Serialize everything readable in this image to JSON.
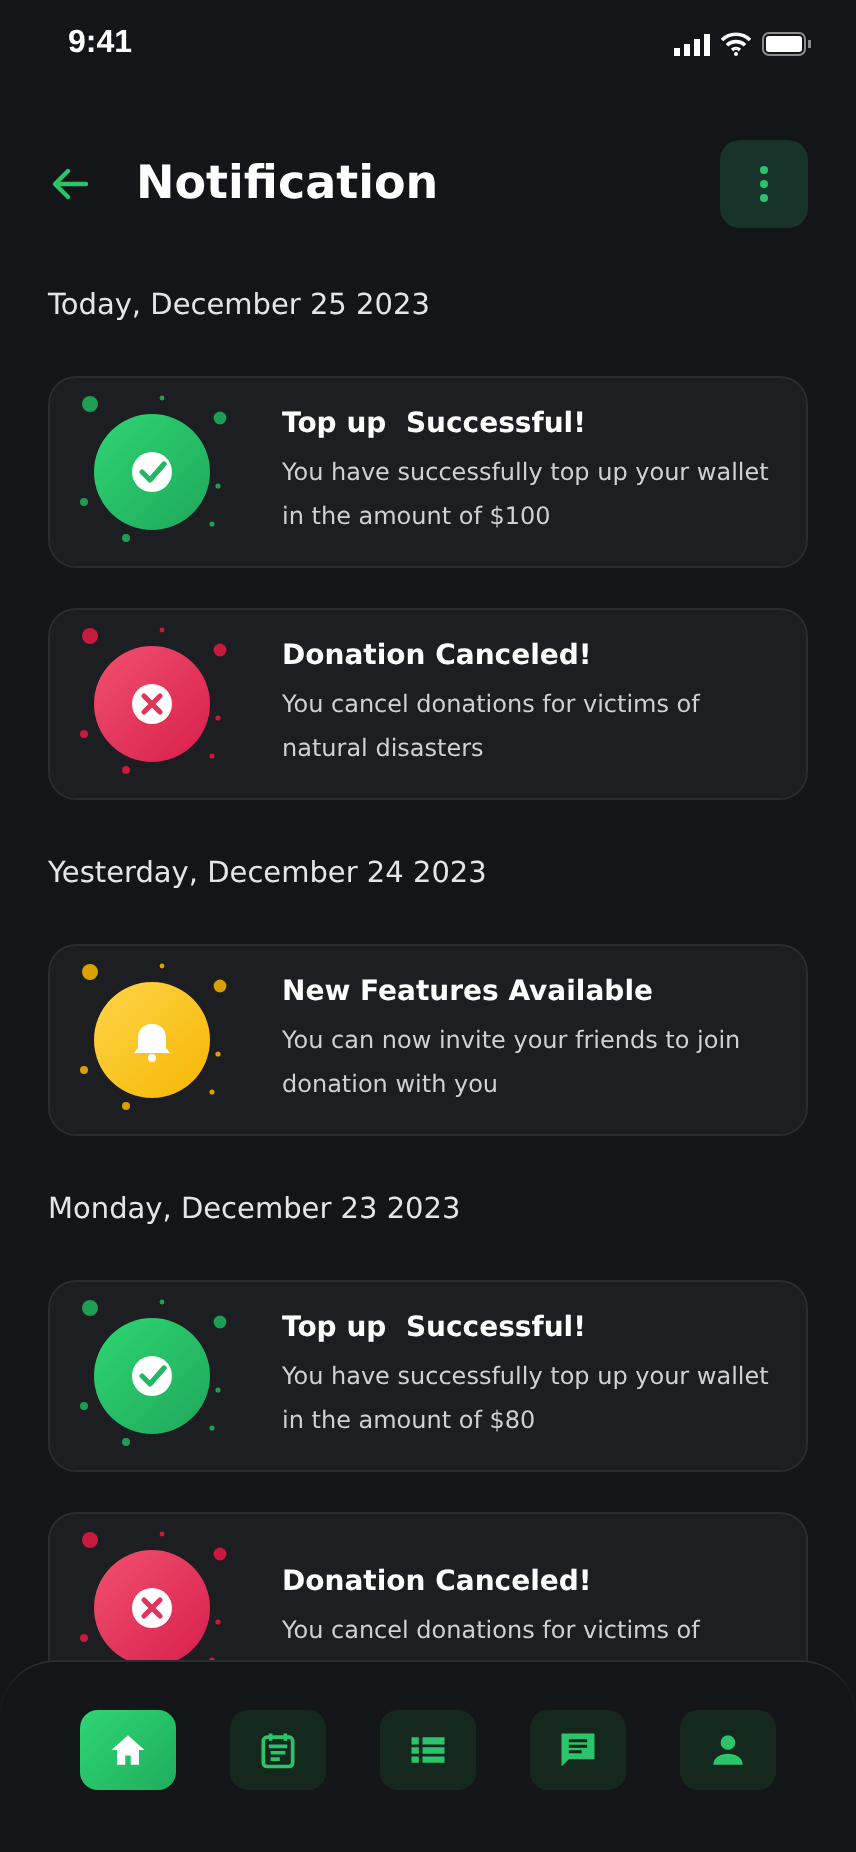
{
  "status_bar": {
    "time": "9:41"
  },
  "header": {
    "title": "Notification"
  },
  "sections": [
    {
      "date": "Today, December 25 2023",
      "notifications": [
        {
          "kind": "success",
          "title": "Top up  Successful!",
          "body": "You have successfully top up your wallet in the amount of $100"
        },
        {
          "kind": "cancel",
          "title": "Donation Canceled!",
          "body": "You cancel donations for victims of natural disasters"
        }
      ]
    },
    {
      "date": "Yesterday, December 24 2023",
      "notifications": [
        {
          "kind": "feature",
          "title": "New Features Available",
          "body": "You can now invite your friends to join donation with you"
        }
      ]
    },
    {
      "date": "Monday, December 23 2023",
      "notifications": [
        {
          "kind": "success",
          "title": "Top up  Successful!",
          "body": "You have successfully top up your wallet in the amount of $80"
        },
        {
          "kind": "cancel",
          "title": "Donation Canceled!",
          "body": "You cancel donations for victims of"
        }
      ]
    }
  ],
  "bottom_nav": [
    {
      "kind": "home",
      "selected": true
    },
    {
      "kind": "calendar",
      "selected": false
    },
    {
      "kind": "list",
      "selected": false
    },
    {
      "kind": "chat",
      "selected": false
    },
    {
      "kind": "profile",
      "selected": false
    }
  ]
}
